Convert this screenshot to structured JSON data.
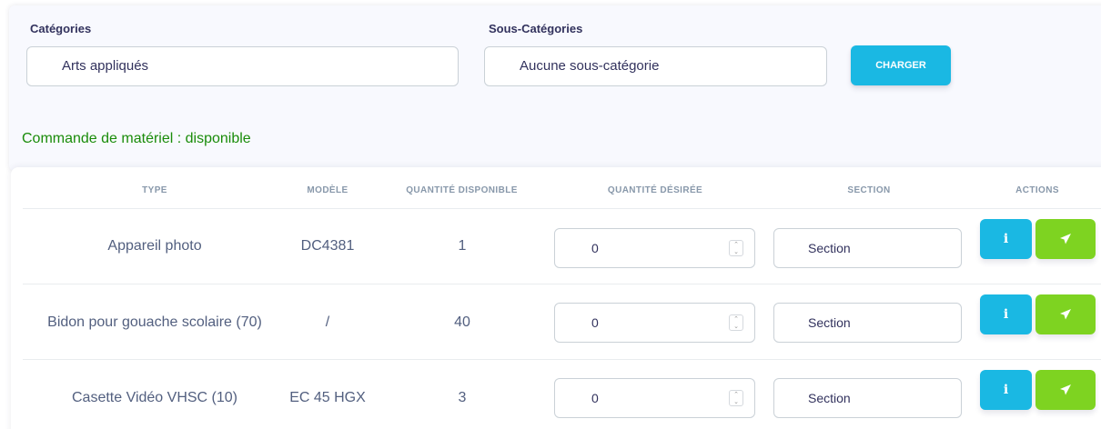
{
  "filters": {
    "categories_label": "Catégories",
    "categories_value": "Arts appliqués",
    "subcategories_label": "Sous-Catégories",
    "subcategories_value": "Aucune sous-catégorie",
    "load_button": "CHARGER"
  },
  "status_text": "Commande de matériel : disponible",
  "colors": {
    "accent": "#1ab8e3",
    "send": "#7ed321",
    "status": "#1a8c0a"
  },
  "table": {
    "headers": {
      "type": "TYPE",
      "model": "MODÈLE",
      "available": "QUANTITÉ DISPONIBLE",
      "desired": "QUANTITÉ DÉSIRÉE",
      "section": "SECTION",
      "actions": "ACTIONS"
    },
    "rows": [
      {
        "type": "Appareil photo",
        "model": "DC4381",
        "available": "1",
        "desired": "0",
        "section_placeholder": "Section",
        "info_label": "i",
        "send_icon": "paper-plane-icon"
      },
      {
        "type": "Bidon pour gouache scolaire (70)",
        "model": "/",
        "available": "40",
        "desired": "0",
        "section_placeholder": "Section",
        "info_label": "i",
        "send_icon": "paper-plane-icon"
      },
      {
        "type": "Casette Vidéo VHSC (10)",
        "model": "EC 45 HGX",
        "available": "3",
        "desired": "0",
        "section_placeholder": "Section",
        "info_label": "i",
        "send_icon": "paper-plane-icon"
      }
    ]
  }
}
